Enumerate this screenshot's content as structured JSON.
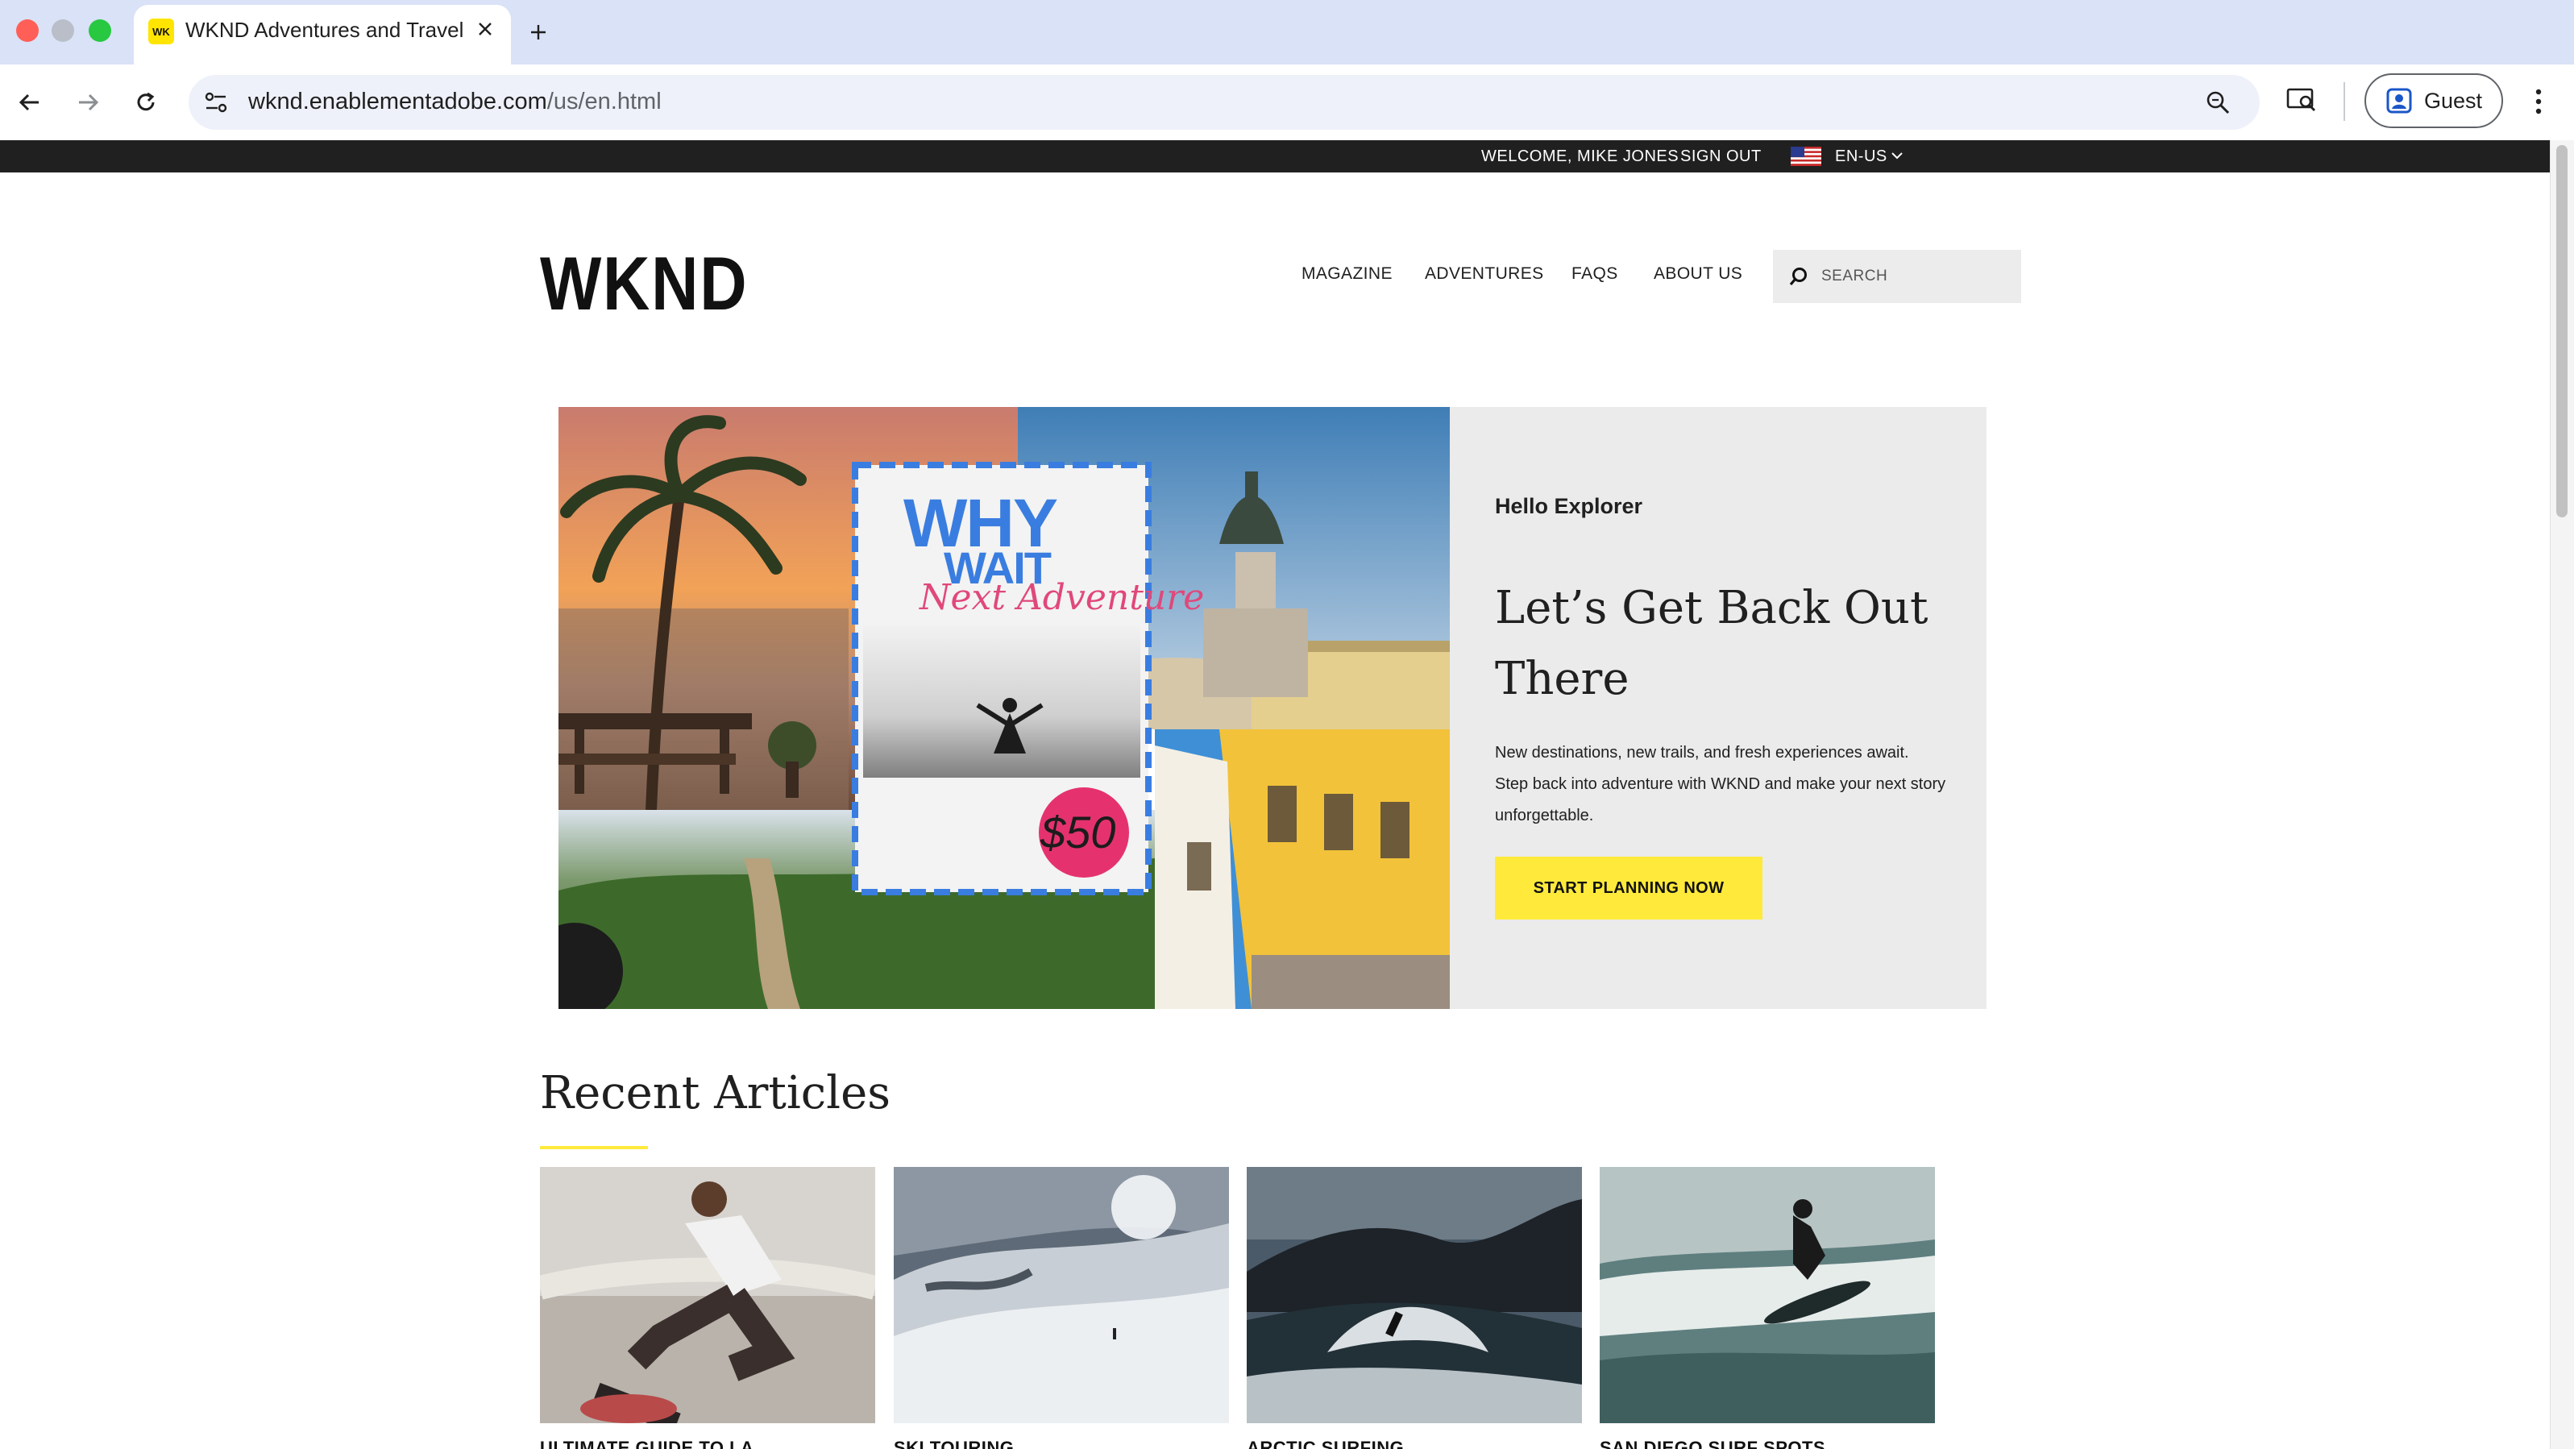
{
  "browser": {
    "tab_title": "WKND Adventures and Travel",
    "tab_favicon_text": "WK",
    "url_host": "wknd.enablementadobe.com",
    "url_path": "/us/en.html",
    "profile_label": "Guest"
  },
  "utility_bar": {
    "welcome": "WELCOME, MIKE JONES",
    "sign_out": "SIGN OUT",
    "language": "EN-US"
  },
  "header": {
    "logo": "WKND",
    "nav": [
      "MAGAZINE",
      "ADVENTURES",
      "FAQS",
      "ABOUT US"
    ],
    "search_placeholder": "SEARCH"
  },
  "hero": {
    "collage_text_1": "WHY",
    "collage_text_2": "WAIT",
    "collage_text_3": "Next Adventure",
    "price_badge": "$50",
    "kicker": "Hello Explorer",
    "headline": "Let’s Get Back Out There",
    "body": "New destinations, new trails, and fresh experiences await. Step back into adventure with WKND and make your next story unforgettable.",
    "cta": "START PLANNING NOW"
  },
  "recent_articles": {
    "heading": "Recent Articles",
    "articles": [
      {
        "title": "ULTIMATE GUIDE TO LA"
      },
      {
        "title": "SKI TOURING"
      },
      {
        "title": "ARCTIC SURFING"
      },
      {
        "title": "SAN DIEGO SURF SPOTS"
      }
    ]
  },
  "colors": {
    "accent_yellow": "#ffea3b",
    "utility_bar": "#202020",
    "hero_panel": "#ebebeb",
    "tabstrip": "#d9e2f6"
  },
  "icons": [
    "back-arrow-icon",
    "forward-arrow-icon",
    "reload-icon",
    "site-settings-icon",
    "zoom-icon",
    "cast-search-icon",
    "profile-icon",
    "menu-dots-icon",
    "us-flag-icon",
    "chevron-down-icon",
    "search-icon",
    "close-icon",
    "plus-icon"
  ]
}
